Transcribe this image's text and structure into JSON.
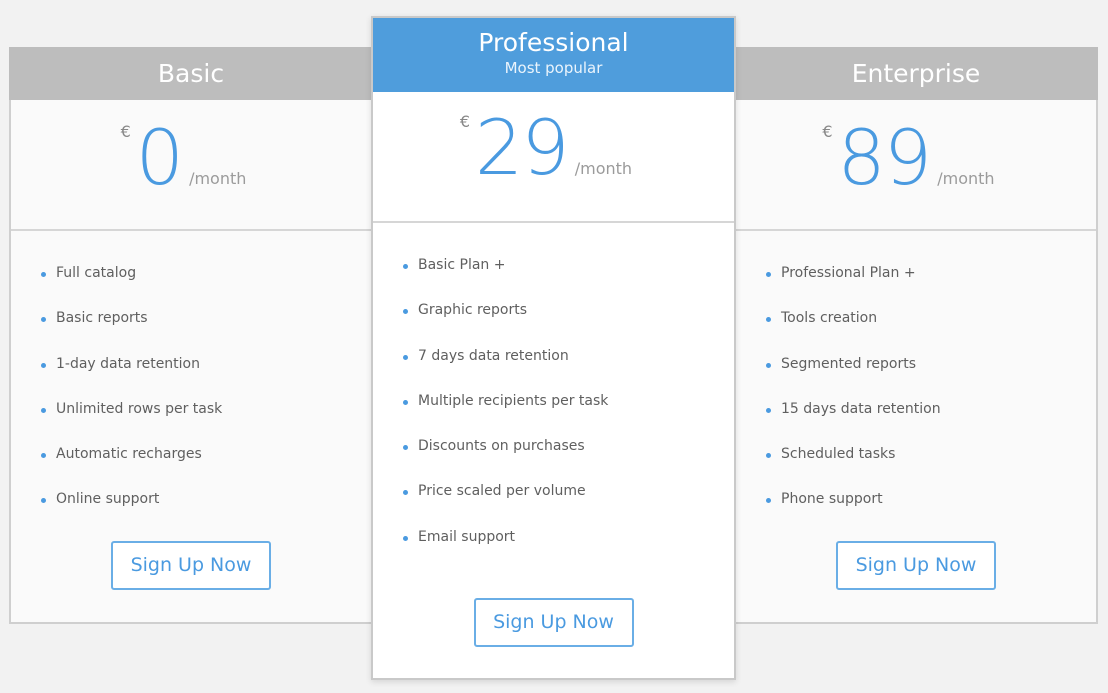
{
  "colors": {
    "accent": "#4a9ae0",
    "featured_header": "#4f9ddc",
    "header_gray": "#bdbdbd",
    "background": "#f2f2f2"
  },
  "plans": [
    {
      "name": "Basic",
      "currency": "€",
      "price": "0",
      "period": "/month",
      "features": [
        "Full catalog",
        "Basic reports",
        "1-day data retention",
        "Unlimited rows per task",
        "Automatic recharges",
        "Online support"
      ],
      "cta": "Sign Up Now"
    },
    {
      "name": "Professional",
      "subtitle": "Most popular",
      "currency": "€",
      "price": "29",
      "period": "/month",
      "features": [
        "Basic Plan +",
        "Graphic reports",
        "7 days data retention",
        "Multiple recipients per task",
        "Discounts on purchases",
        "Price scaled per volume",
        "Email support"
      ],
      "cta": "Sign Up Now"
    },
    {
      "name": "Enterprise",
      "currency": "€",
      "price": "89",
      "period": "/month",
      "features": [
        "Professional Plan +",
        "Tools creation",
        "Segmented reports",
        "15 days data retention",
        "Scheduled tasks",
        "Phone support"
      ],
      "cta": "Sign Up Now"
    }
  ]
}
